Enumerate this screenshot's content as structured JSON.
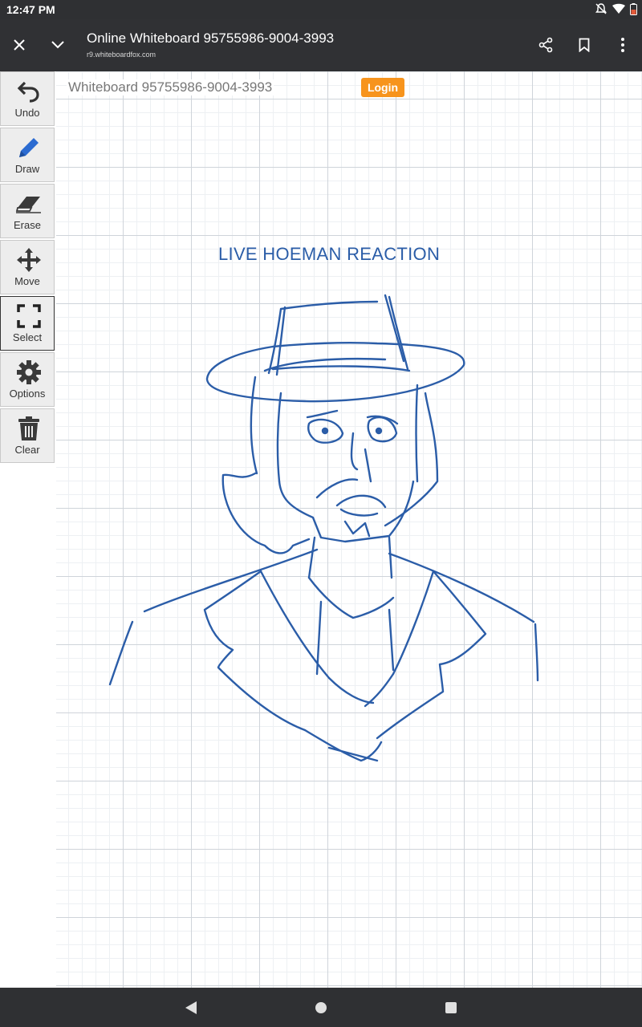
{
  "status_bar": {
    "time": "12:47 PM"
  },
  "app_bar": {
    "title": "Online Whiteboard 95755986-9004-3993",
    "url": "r9.whiteboardfox.com"
  },
  "board": {
    "title": "Whiteboard 95755986-9004-3993",
    "login_label": "Login",
    "drawing_text": "LIVE HOEMAN REACTION",
    "ink_color": "#2b5da8"
  },
  "toolbar": {
    "items": [
      {
        "label": "Undo",
        "icon": "undo-icon"
      },
      {
        "label": "Draw",
        "icon": "pencil-icon"
      },
      {
        "label": "Erase",
        "icon": "eraser-icon"
      },
      {
        "label": "Move",
        "icon": "move-icon"
      },
      {
        "label": "Select",
        "icon": "select-icon",
        "active": true
      },
      {
        "label": "Options",
        "icon": "gear-icon"
      },
      {
        "label": "Clear",
        "icon": "trash-icon"
      }
    ]
  },
  "colors": {
    "accent": "#f7941d",
    "toolbar_bg": "#ededed",
    "chrome": "#303134"
  }
}
